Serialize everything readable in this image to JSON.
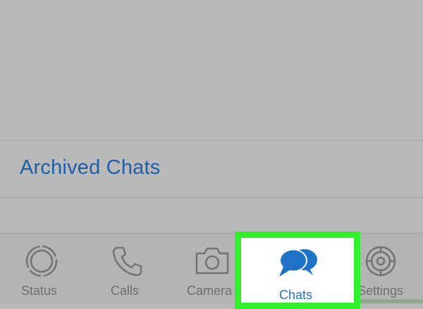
{
  "archived": {
    "label": "Archived Chats"
  },
  "tabbar": {
    "tabs": [
      {
        "label": "Status",
        "icon": "status-ring-icon"
      },
      {
        "label": "Calls",
        "icon": "phone-icon"
      },
      {
        "label": "Camera",
        "icon": "camera-icon"
      },
      {
        "label": "Chats",
        "icon": "chat-bubbles-icon",
        "selected": true
      },
      {
        "label": "Settings",
        "icon": "gear-icon"
      }
    ]
  },
  "colors": {
    "accent": "#1e73c9",
    "highlight_border": "#33f02e",
    "inactive": "#6e6e6e"
  }
}
